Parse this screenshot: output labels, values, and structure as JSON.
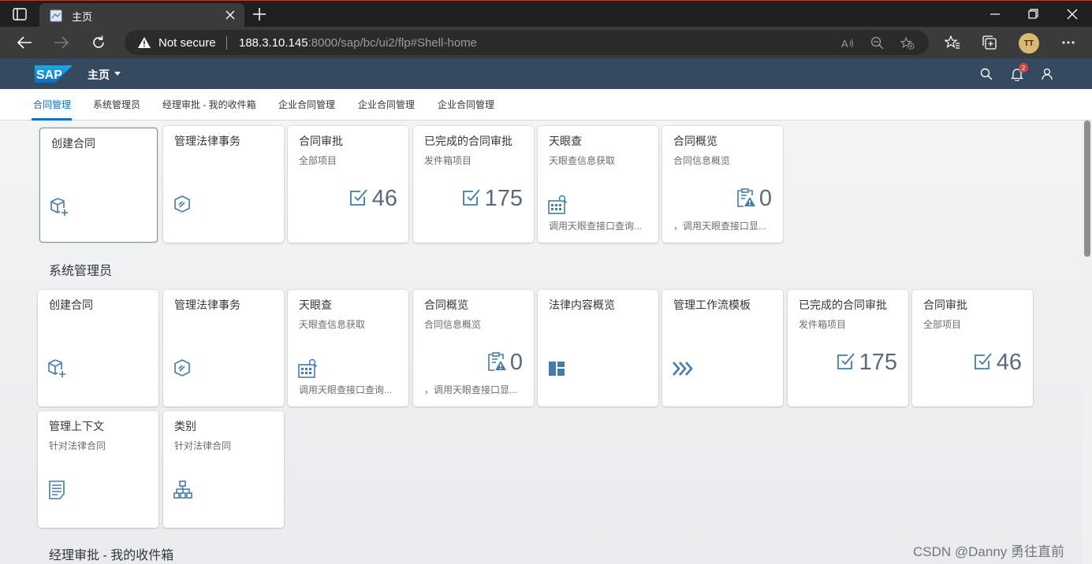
{
  "browser": {
    "tab_title": "主页",
    "security_label": "Not secure",
    "url_host": "188.3.10.145",
    "url_rest": ":8000/sap/bc/ui2/flp#Shell-home",
    "profile_initials": "TT"
  },
  "shell": {
    "title": "主页",
    "notification_count": "2"
  },
  "anchor_nav": [
    {
      "label": "合同管理",
      "active": true
    },
    {
      "label": "系统管理员",
      "active": false
    },
    {
      "label": "经理审批 - 我的收件箱",
      "active": false
    },
    {
      "label": "企业合同管理",
      "active": false
    },
    {
      "label": "企业合同管理",
      "active": false
    },
    {
      "label": "企业合同管理",
      "active": false
    }
  ],
  "groups": [
    {
      "title": "",
      "tiles": [
        {
          "title": "创建合同",
          "subtitle": "",
          "icon": "create-contract-icon",
          "kpi": "",
          "footer": ""
        },
        {
          "title": "管理法律事务",
          "subtitle": "",
          "icon": "legal-matter-icon",
          "kpi": "",
          "footer": ""
        },
        {
          "title": "合同审批",
          "subtitle": "全部项目",
          "icon": "checkbox-icon",
          "kpi": "46",
          "footer": ""
        },
        {
          "title": "已完成的合同审批",
          "subtitle": "发件箱项目",
          "icon": "checkbox-icon",
          "kpi": "175",
          "footer": ""
        },
        {
          "title": "天眼查",
          "subtitle": "天眼查信息获取",
          "icon": "building-search-icon",
          "kpi": "",
          "footer": "调用天眼查接口查询..."
        },
        {
          "title": "合同概览",
          "subtitle": "合同信息概览",
          "icon": "clipboard-warning-icon",
          "kpi": "0",
          "footer": "，调用天眼查接口显..."
        }
      ]
    },
    {
      "title": "系统管理员",
      "tiles": [
        {
          "title": "创建合同",
          "subtitle": "",
          "icon": "create-contract-icon",
          "kpi": "",
          "footer": ""
        },
        {
          "title": "管理法律事务",
          "subtitle": "",
          "icon": "legal-matter-icon",
          "kpi": "",
          "footer": ""
        },
        {
          "title": "天眼查",
          "subtitle": "天眼查信息获取",
          "icon": "building-search-icon",
          "kpi": "",
          "footer": "调用天眼查接口查询..."
        },
        {
          "title": "合同概览",
          "subtitle": "合同信息概览",
          "icon": "clipboard-warning-icon",
          "kpi": "0",
          "footer": "，调用天眼查接口显..."
        },
        {
          "title": "法律内容概览",
          "subtitle": "",
          "icon": "dashboard-icon",
          "kpi": "",
          "footer": ""
        },
        {
          "title": "管理工作流模板",
          "subtitle": "",
          "icon": "chevrons-right-icon",
          "kpi": "",
          "footer": ""
        },
        {
          "title": "已完成的合同审批",
          "subtitle": "发件箱项目",
          "icon": "checkbox-icon",
          "kpi": "175",
          "footer": ""
        },
        {
          "title": "合同审批",
          "subtitle": "全部项目",
          "icon": "checkbox-icon",
          "kpi": "46",
          "footer": ""
        },
        {
          "title": "管理上下文",
          "subtitle": "针对法律合同",
          "icon": "document-list-icon",
          "kpi": "",
          "footer": ""
        },
        {
          "title": "类别",
          "subtitle": "针对法律合同",
          "icon": "hierarchy-icon",
          "kpi": "",
          "footer": ""
        }
      ]
    },
    {
      "title": "经理审批 - 我的收件箱",
      "tiles": []
    }
  ],
  "watermark": "CSDN @Danny 勇往直前",
  "colors": {
    "shell": "#354a5f",
    "accent": "#0a6ed1",
    "icon": "#427cac"
  }
}
